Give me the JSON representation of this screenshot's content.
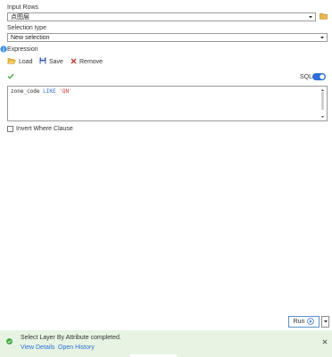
{
  "input_rows": {
    "label": "Input Rows",
    "value": "点图层"
  },
  "selection_type": {
    "label": "Selection type",
    "value": "New selection"
  },
  "expression": {
    "label": "Expression",
    "toolbar": {
      "load": "Load",
      "save": "Save",
      "remove": "Remove"
    },
    "sql_label": "SQL",
    "sql_enabled": true,
    "code": {
      "field": "zone_code",
      "operator": "LIKE",
      "value": "'QN'"
    }
  },
  "invert_where": {
    "label": "Invert Where Clause",
    "checked": false
  },
  "run_button": {
    "label": "Run"
  },
  "status": {
    "message": "Select Layer By Attribute completed.",
    "view_details": "View Details",
    "open_history": "Open History"
  },
  "colors": {
    "accent": "#2d6fd6",
    "success": "#3aa53a",
    "status_bg": "#e7f4e4",
    "remove_red": "#c0392b"
  }
}
